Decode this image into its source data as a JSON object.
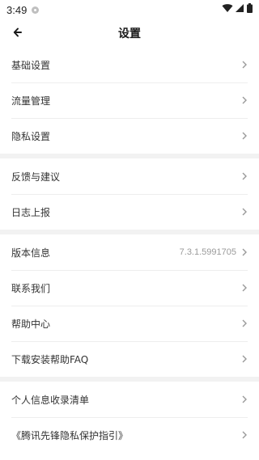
{
  "status_bar": {
    "time": "3:49",
    "icons": [
      "notification-dot-icon",
      "wifi-icon",
      "signal-icon",
      "battery-icon"
    ]
  },
  "header": {
    "title": "设置",
    "back_icon": "back-arrow-icon"
  },
  "sections": [
    {
      "items": [
        {
          "label": "基础设置"
        },
        {
          "label": "流量管理"
        },
        {
          "label": "隐私设置"
        }
      ]
    },
    {
      "items": [
        {
          "label": "反馈与建议"
        },
        {
          "label": "日志上报"
        }
      ]
    },
    {
      "items": [
        {
          "label": "版本信息",
          "value": "7.3.1.5991705"
        },
        {
          "label": "联系我们"
        },
        {
          "label": "帮助中心"
        },
        {
          "label": "下载安装帮助FAQ"
        }
      ]
    },
    {
      "items": [
        {
          "label": "个人信息收录清单"
        },
        {
          "label": "《腾讯先锋隐私保护指引》"
        }
      ]
    }
  ],
  "colors": {
    "text": "#333333",
    "secondary": "#9a9a9a",
    "divider": "#eeeeee",
    "section_gap": "#f2f2f2",
    "chevron": "#999999"
  }
}
